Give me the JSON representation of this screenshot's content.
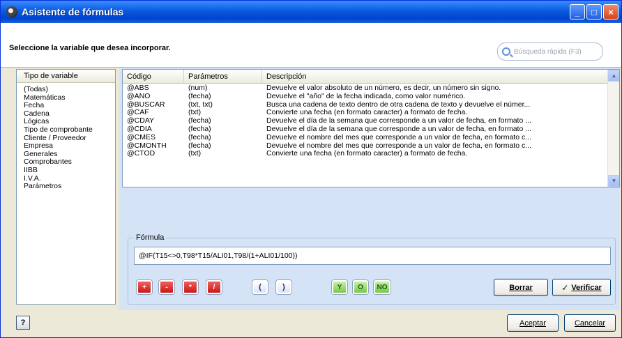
{
  "window": {
    "title": "Asistente de fórmulas",
    "min": "_",
    "max": "□",
    "close": "×"
  },
  "header": {
    "label": "Seleccione la variable que desea incorporar.",
    "search_placeholder": "Búsqueda rápida (F3)"
  },
  "variable_types": {
    "header": "Tipo de variable",
    "items": [
      "(Todas)",
      "Matemáticas",
      "Fecha",
      "Cadena",
      "Lógicas",
      "Tipo de comprobante",
      "Cliente / Proveedor",
      "Empresa",
      "Generales",
      "Comprobantes",
      "IIBB",
      "I.V.A.",
      "Parámetros"
    ]
  },
  "functions": {
    "columns": [
      "Código",
      "Parámetros",
      "Descripción"
    ],
    "rows": [
      [
        "@ABS",
        "(num)",
        "Devuelve el valor absoluto de un número, es decir, un número sin signo."
      ],
      [
        "@AÑO",
        "(fecha)",
        "Devuelve el \"año\" de la fecha indicada, como valor numérico."
      ],
      [
        "@BUSCAR",
        "(txt, txt)",
        "Busca una cadena de texto dentro de otra cadena de texto y devuelve el númer..."
      ],
      [
        "@CAF",
        "(txt)",
        "Convierte una fecha (en formato caracter) a formato de fecha."
      ],
      [
        "@CDAY",
        "(fecha)",
        "Devuelve el día de la semana que corresponde a un valor de fecha, en formato ..."
      ],
      [
        "@CDIA",
        "(fecha)",
        "Devuelve el día de la semana que corresponde a un valor de fecha, en formato ..."
      ],
      [
        "@CMES",
        "(fecha)",
        "Devuelve el nombre del mes que corresponde a un valor de fecha, en formato c..."
      ],
      [
        "@CMONTH",
        "(fecha)",
        "Devuelve el nombre del mes que corresponde a un valor de fecha, en formato c..."
      ],
      [
        "@CTOD",
        "(txt)",
        "Convierte una fecha (en formato caracter) a formato de fecha."
      ]
    ]
  },
  "formula": {
    "label": "Fórmula",
    "value": "@IF(T15<>0,T98*T15/ALI01,T98/(1+ALI01/100))",
    "operators": {
      "plus": "+",
      "minus": "-",
      "times": "*",
      "divide": "/",
      "open_paren": "(",
      "close_paren": ")",
      "y": "Y",
      "o": "O",
      "no": "NO"
    },
    "clear_label": "Borrar",
    "verify_label": "Verificar"
  },
  "footer": {
    "help": "?",
    "accept_label": "Aceptar",
    "cancel_label": "Cancelar"
  }
}
